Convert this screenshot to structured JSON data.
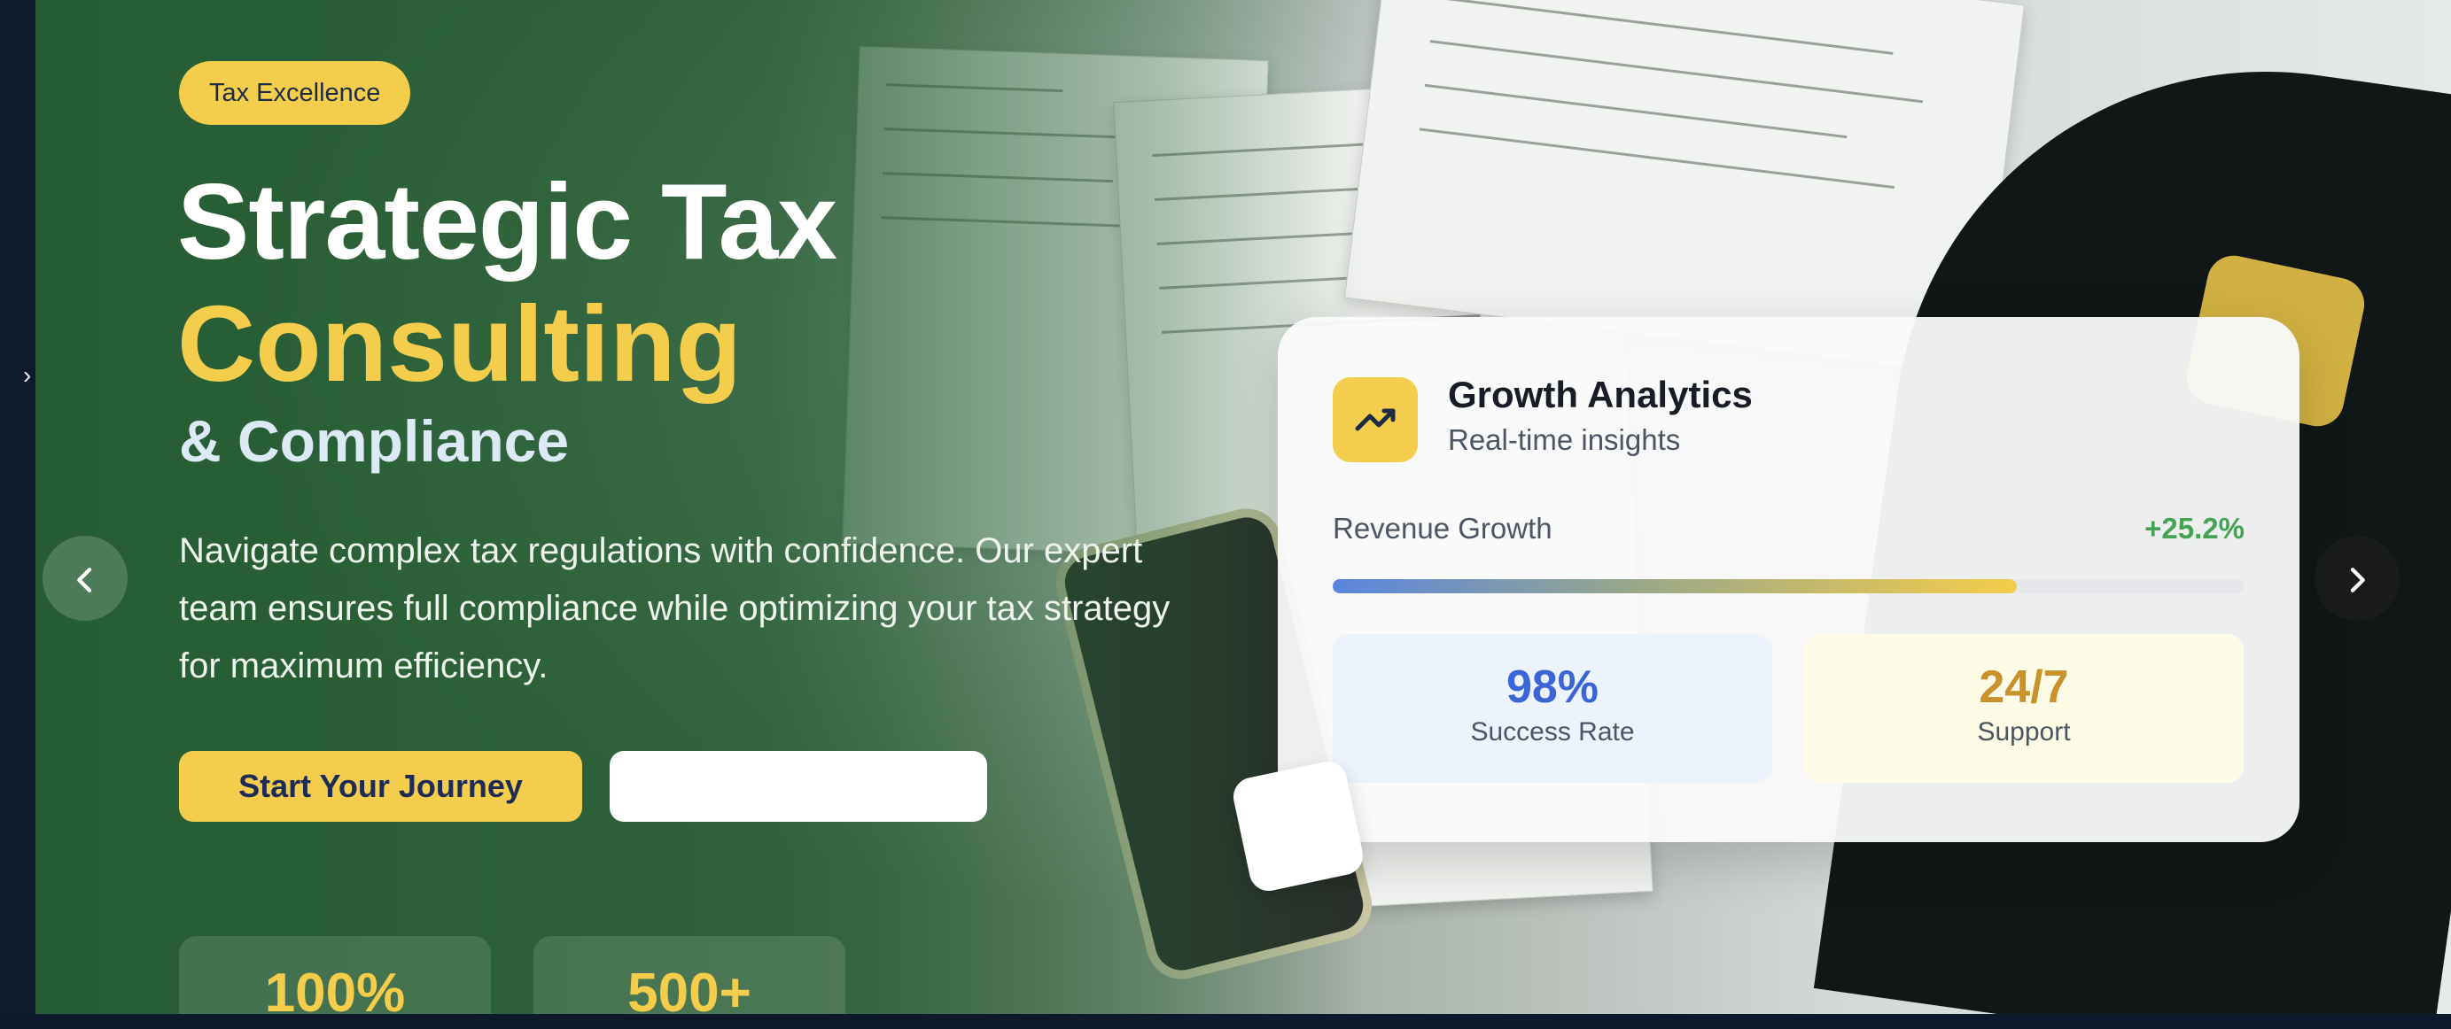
{
  "hero": {
    "badge": "Tax Excellence",
    "title_line1": "Strategic Tax",
    "title_line2": "Consulting",
    "title_line3": "& Compliance",
    "description": "Navigate complex tax regulations with confidence. Our expert team ensures full compliance while optimizing your tax strategy for maximum efficiency.",
    "primary_button": "Start Your Journey",
    "secondary_button": ""
  },
  "stats": [
    {
      "value": "100%"
    },
    {
      "value": "500+"
    }
  ],
  "card": {
    "title": "Growth Analytics",
    "subtitle": "Real-time insights",
    "revenue_label": "Revenue Growth",
    "revenue_value": "+25.2%",
    "progress_fraction": 0.75,
    "metrics": [
      {
        "value": "98%",
        "label": "Success Rate",
        "color": "#3a64d8"
      },
      {
        "value": "24/7",
        "label": "Support",
        "color": "#c8912c"
      }
    ]
  },
  "icons": {
    "card_icon": "trending-up-icon",
    "prev": "chevron-left-icon",
    "next": "chevron-right-icon",
    "rail": "chevron-right-icon"
  },
  "colors": {
    "accent_yellow": "#f3cd4b",
    "hero_green": "#265d34",
    "positive_green": "#43a353"
  }
}
